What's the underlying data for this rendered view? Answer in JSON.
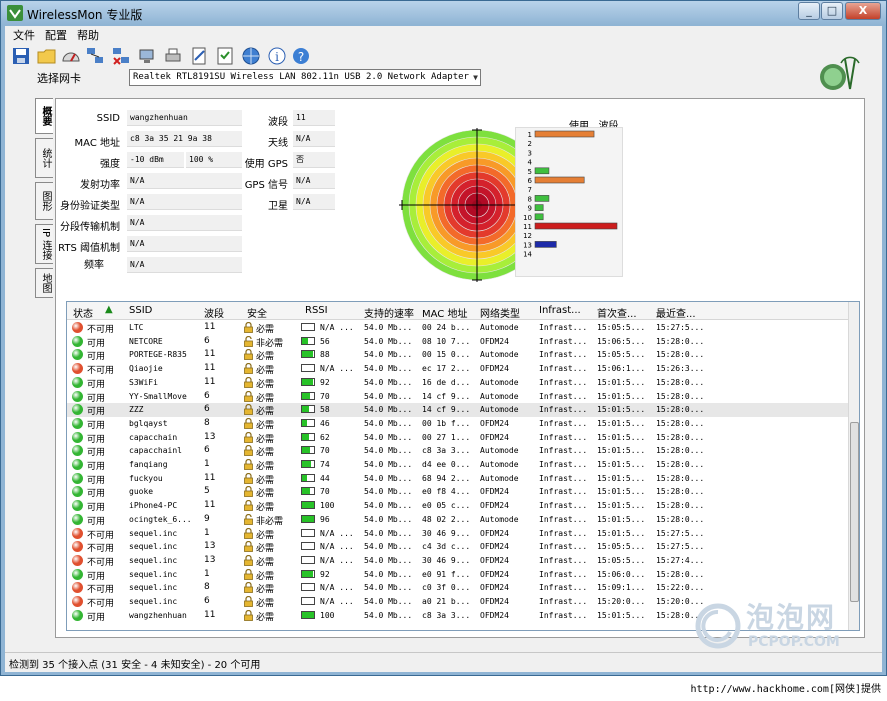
{
  "window": {
    "title": "WirelessMon 专业版"
  },
  "window_controls": {
    "minimize": "_",
    "maximize": "□",
    "close": "X"
  },
  "menu": [
    "文件",
    "配置",
    "帮助"
  ],
  "toolbar": {
    "icons": [
      "save-icon",
      "open-folder-icon",
      "gauge-icon",
      "network-icon",
      "disconnect-icon",
      "monitor-icon",
      "print-icon",
      "edit-icon",
      "checklist-icon",
      "globe-icon",
      "info-icon",
      "help-icon"
    ]
  },
  "adapter": {
    "label": "选择网卡",
    "selected": "Realtek RTL8191SU Wireless LAN 802.11n USB 2.0 Network Adapter"
  },
  "side_tabs": [
    "概要",
    "统计",
    "图形",
    "IP 连接",
    "地图"
  ],
  "summary": {
    "left": [
      {
        "label": "SSID",
        "value": "wangzhenhuan"
      },
      {
        "label": "MAC 地址",
        "value": "c8 3a 35 21 9a 38"
      },
      {
        "label": "强度",
        "value": "-10 dBm",
        "value2": "100 %"
      },
      {
        "label": "发射功率",
        "value": "N/A"
      },
      {
        "label": "身份验证类型",
        "value": "N/A"
      },
      {
        "label": "分段传输机制",
        "value": "N/A"
      },
      {
        "label": "RTS 阈值机制",
        "value": "N/A"
      },
      {
        "label": "频率",
        "value": "N/A"
      }
    ],
    "right": [
      {
        "label": "波段",
        "value": "11"
      },
      {
        "label": "天线",
        "value": "N/A"
      },
      {
        "label": "使用 GPS",
        "value": "否"
      },
      {
        "label": "GPS 信号",
        "value": "N/A"
      },
      {
        "label": "卫星",
        "value": "N/A"
      }
    ]
  },
  "channel_usage": {
    "title": "使用...波段",
    "channels": [
      "1",
      "2",
      "3",
      "4",
      "5",
      "6",
      "7",
      "8",
      "9",
      "10",
      "11",
      "12",
      "13",
      "14"
    ],
    "bars": [
      {
        "channel": "1",
        "level": 0.72,
        "color": "#e57f35"
      },
      {
        "channel": "5",
        "level": 0.17,
        "color": "#3fbf3f"
      },
      {
        "channel": "6",
        "level": 0.6,
        "color": "#e57f35"
      },
      {
        "channel": "8",
        "level": 0.17,
        "color": "#3fbf3f"
      },
      {
        "channel": "9",
        "level": 0.1,
        "color": "#3fbf3f"
      },
      {
        "channel": "10",
        "level": 0.1,
        "color": "#3fbf3f"
      },
      {
        "channel": "11",
        "level": 1.0,
        "color": "#cc1d1d"
      },
      {
        "channel": "13",
        "level": 0.26,
        "color": "#1d2aa8"
      }
    ]
  },
  "list": {
    "columns": [
      "状态",
      "SSID",
      "波段",
      "安全",
      "RSSI",
      "支持的速率",
      "MAC 地址",
      "网络类型",
      "Infrast...",
      "首次查...",
      "最近查..."
    ],
    "rows": [
      {
        "status": "不可用",
        "ok": false,
        "ssid": "LTC",
        "ch": "11",
        "sec": "必需",
        "rssi": "N/A ...",
        "lvl": 0.0,
        "rate": "54.0 Mb...",
        "mac": "00 24 b...",
        "type": "Automode",
        "infra": "Infrast...",
        "first": "15:05:5...",
        "last": "15:27:5..."
      },
      {
        "status": "可用",
        "ok": true,
        "ssid": "NETCORE",
        "ch": "6",
        "sec": "非必需",
        "rssi": "56",
        "lvl": 0.5,
        "rate": "54.0 Mb...",
        "mac": "08 10 7...",
        "type": "OFDM24",
        "infra": "Infrast...",
        "first": "15:06:5...",
        "last": "15:28:0..."
      },
      {
        "status": "可用",
        "ok": true,
        "ssid": "PORTEGE-R835",
        "ch": "11",
        "sec": "必需",
        "rssi": "88",
        "lvl": 0.9,
        "rate": "54.0 Mb...",
        "mac": "00 15 0...",
        "type": "Automode",
        "infra": "Infrast...",
        "first": "15:05:5...",
        "last": "15:28:0..."
      },
      {
        "status": "不可用",
        "ok": false,
        "ssid": "Qiaojie",
        "ch": "11",
        "sec": "必需",
        "rssi": "N/A ...",
        "lvl": 0.0,
        "rate": "54.0 Mb...",
        "mac": "ec 17 2...",
        "type": "OFDM24",
        "infra": "Infrast...",
        "first": "15:06:1...",
        "last": "15:26:3..."
      },
      {
        "status": "可用",
        "ok": true,
        "ssid": "S3WiFi",
        "ch": "11",
        "sec": "必需",
        "rssi": "92",
        "lvl": 0.92,
        "rate": "54.0 Mb...",
        "mac": "16 de d...",
        "type": "Automode",
        "infra": "Infrast...",
        "first": "15:01:5...",
        "last": "15:28:0..."
      },
      {
        "status": "可用",
        "ok": true,
        "ssid": "YY-SmallMove",
        "ch": "6",
        "sec": "必需",
        "rssi": "70",
        "lvl": 0.7,
        "rate": "54.0 Mb...",
        "mac": "14 cf 9...",
        "type": "Automode",
        "infra": "Infrast...",
        "first": "15:01:5...",
        "last": "15:28:0..."
      },
      {
        "status": "可用",
        "ok": true,
        "ssid": "ZZZ",
        "ch": "6",
        "sec": "必需",
        "rssi": "58",
        "lvl": 0.55,
        "rate": "54.0 Mb...",
        "mac": "14 cf 9...",
        "type": "Automode",
        "infra": "Infrast...",
        "first": "15:01:5...",
        "last": "15:28:0..."
      },
      {
        "status": "可用",
        "ok": true,
        "ssid": "bglqayst",
        "ch": "8",
        "sec": "必需",
        "rssi": "46",
        "lvl": 0.45,
        "rate": "54.0 Mb...",
        "mac": "00 1b f...",
        "type": "OFDM24",
        "infra": "Infrast...",
        "first": "15:01:5...",
        "last": "15:28:0..."
      },
      {
        "status": "可用",
        "ok": true,
        "ssid": "capacchain",
        "ch": "13",
        "sec": "必需",
        "rssi": "62",
        "lvl": 0.6,
        "rate": "54.0 Mb...",
        "mac": "00 27 1...",
        "type": "OFDM24",
        "infra": "Infrast...",
        "first": "15:01:5...",
        "last": "15:28:0..."
      },
      {
        "status": "可用",
        "ok": true,
        "ssid": "capacchainl",
        "ch": "6",
        "sec": "必需",
        "rssi": "70",
        "lvl": 0.7,
        "rate": "54.0 Mb...",
        "mac": "c8 3a 3...",
        "type": "Automode",
        "infra": "Infrast...",
        "first": "15:01:5...",
        "last": "15:28:0..."
      },
      {
        "status": "可用",
        "ok": true,
        "ssid": "fanqiang",
        "ch": "1",
        "sec": "必需",
        "rssi": "74",
        "lvl": 0.72,
        "rate": "54.0 Mb...",
        "mac": "d4 ee 0...",
        "type": "Automode",
        "infra": "Infrast...",
        "first": "15:01:5...",
        "last": "15:28:0..."
      },
      {
        "status": "可用",
        "ok": true,
        "ssid": "fuckyou",
        "ch": "11",
        "sec": "必需",
        "rssi": "44",
        "lvl": 0.4,
        "rate": "54.0 Mb...",
        "mac": "68 94 2...",
        "type": "Automode",
        "infra": "Infrast...",
        "first": "15:01:5...",
        "last": "15:28:0..."
      },
      {
        "status": "可用",
        "ok": true,
        "ssid": "guoke",
        "ch": "5",
        "sec": "必需",
        "rssi": "70",
        "lvl": 0.7,
        "rate": "54.0 Mb...",
        "mac": "e0 f8 4...",
        "type": "OFDM24",
        "infra": "Infrast...",
        "first": "15:01:5...",
        "last": "15:28:0..."
      },
      {
        "status": "可用",
        "ok": true,
        "ssid": "iPhone4-PC",
        "ch": "11",
        "sec": "必需",
        "rssi": "100",
        "lvl": 1.0,
        "rate": "54.0 Mb...",
        "mac": "e0 05 c...",
        "type": "OFDM24",
        "infra": "Infrast...",
        "first": "15:01:5...",
        "last": "15:28:0..."
      },
      {
        "status": "可用",
        "ok": true,
        "ssid": "ocingtek_6...",
        "ch": "9",
        "sec": "非必需",
        "rssi": "96",
        "lvl": 0.96,
        "rate": "54.0 Mb...",
        "mac": "48 02 2...",
        "type": "Automode",
        "infra": "Infrast...",
        "first": "15:01:5...",
        "last": "15:28:0..."
      },
      {
        "status": "不可用",
        "ok": false,
        "ssid": "sequel.inc",
        "ch": "1",
        "sec": "必需",
        "rssi": "N/A ...",
        "lvl": 0.0,
        "rate": "54.0 Mb...",
        "mac": "30 46 9...",
        "type": "OFDM24",
        "infra": "Infrast...",
        "first": "15:01:5...",
        "last": "15:27:5..."
      },
      {
        "status": "不可用",
        "ok": false,
        "ssid": "sequel.inc",
        "ch": "13",
        "sec": "必需",
        "rssi": "N/A ...",
        "lvl": 0.0,
        "rate": "54.0 Mb...",
        "mac": "c4 3d c...",
        "type": "OFDM24",
        "infra": "Infrast...",
        "first": "15:05:5...",
        "last": "15:27:5..."
      },
      {
        "status": "不可用",
        "ok": false,
        "ssid": "sequel.inc",
        "ch": "13",
        "sec": "必需",
        "rssi": "N/A ...",
        "lvl": 0.0,
        "rate": "54.0 Mb...",
        "mac": "30 46 9...",
        "type": "OFDM24",
        "infra": "Infrast...",
        "first": "15:05:5...",
        "last": "15:27:4..."
      },
      {
        "status": "可用",
        "ok": true,
        "ssid": "sequel.inc",
        "ch": "1",
        "sec": "必需",
        "rssi": "92",
        "lvl": 0.92,
        "rate": "54.0 Mb...",
        "mac": "e0 91 f...",
        "type": "OFDM24",
        "infra": "Infrast...",
        "first": "15:06:0...",
        "last": "15:28:0..."
      },
      {
        "status": "不可用",
        "ok": false,
        "ssid": "sequel.inc",
        "ch": "8",
        "sec": "必需",
        "rssi": "N/A ...",
        "lvl": 0.0,
        "rate": "54.0 Mb...",
        "mac": "c0 3f 0...",
        "type": "OFDM24",
        "infra": "Infrast...",
        "first": "15:09:1...",
        "last": "15:22:0..."
      },
      {
        "status": "不可用",
        "ok": false,
        "ssid": "sequel.inc",
        "ch": "6",
        "sec": "必需",
        "rssi": "N/A ...",
        "lvl": 0.0,
        "rate": "54.0 Mb...",
        "mac": "a0 21 b...",
        "type": "OFDM24",
        "infra": "Infrast...",
        "first": "15:20:0...",
        "last": "15:20:0..."
      },
      {
        "status": "可用",
        "ok": true,
        "ssid": "wangzhenhuan",
        "ch": "11",
        "sec": "必需",
        "rssi": "100",
        "lvl": 1.0,
        "rate": "54.0 Mb...",
        "mac": "c8 3a 3...",
        "type": "OFDM24",
        "infra": "Infrast...",
        "first": "15:01:5...",
        "last": "15:28:0..."
      }
    ]
  },
  "status": {
    "text": "检测到 35 个接入点 (31 安全 - 4 未知安全) - 20 个可用"
  },
  "watermark": {
    "big": "泡泡网",
    "small": "PCPOP.COM"
  },
  "footer": {
    "url": "http://www.hackhome.com[网侠]提供"
  },
  "colors": {
    "available": "#33b533",
    "unavailable": "#e0502f",
    "rssi": "#27c227"
  }
}
